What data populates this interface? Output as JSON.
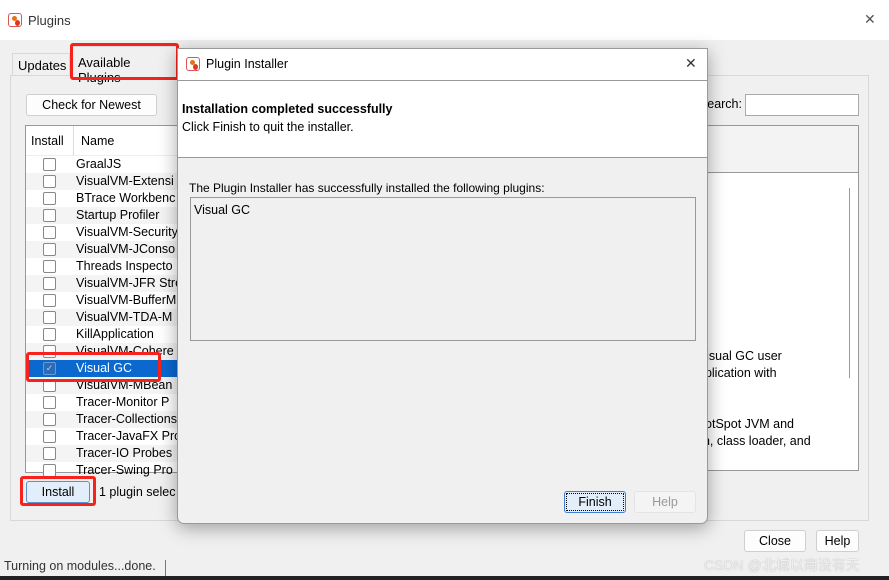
{
  "window": {
    "title": "Plugins",
    "close": "✕"
  },
  "tabs": [
    {
      "label": "Updates"
    },
    {
      "label": "Available Plugins"
    }
  ],
  "toolbar": {
    "check_label": "Check for Newest",
    "search_label": "Search:",
    "search_value": ""
  },
  "table": {
    "headers": [
      "Install",
      "Name"
    ],
    "rows": [
      {
        "name": "GraalJS",
        "checked": false
      },
      {
        "name": "VisualVM-Extensi",
        "checked": false
      },
      {
        "name": "BTrace Workbenc",
        "checked": false
      },
      {
        "name": "Startup Profiler",
        "checked": false
      },
      {
        "name": "VisualVM-Security",
        "checked": false
      },
      {
        "name": "VisualVM-JConso",
        "checked": false
      },
      {
        "name": "Threads Inspecto",
        "checked": false
      },
      {
        "name": "VisualVM-JFR Stre",
        "checked": false
      },
      {
        "name": "VisualVM-BufferM",
        "checked": false
      },
      {
        "name": "VisualVM-TDA-M",
        "checked": false
      },
      {
        "name": "KillApplication",
        "checked": false
      },
      {
        "name": "VisualVM-Cohere",
        "checked": false
      },
      {
        "name": "Visual GC",
        "checked": true,
        "selected": true
      },
      {
        "name": "VisualVM-MBean",
        "checked": false
      },
      {
        "name": "Tracer-Monitor P",
        "checked": false
      },
      {
        "name": "Tracer-Collections",
        "checked": false
      },
      {
        "name": "Tracer-JavaFX Pro",
        "checked": false
      },
      {
        "name": "Tracer-IO Probes",
        "checked": false
      },
      {
        "name": "Tracer-Swing Pro",
        "checked": false
      }
    ]
  },
  "details": {
    "lines": [
      "Visual GC user",
      "pplication with",
      "HotSpot JVM and",
      "on, class loader, and"
    ]
  },
  "bottom": {
    "install_label": "Install",
    "selected_text": "1 plugin selec",
    "close_label": "Close",
    "help_label": "Help"
  },
  "status": {
    "text": "Turning on modules...done."
  },
  "dialog": {
    "title": "Plugin Installer",
    "close": "✕",
    "heading": "Installation completed successfully",
    "subheading": "Click Finish to quit the installer.",
    "body_text": "The Plugin Installer has successfully installed the following plugins:",
    "installed": [
      "Visual GC"
    ],
    "finish_label": "Finish",
    "help_label": "Help"
  },
  "watermark": "CSDN @北城以南没有天",
  "colors": {
    "selection": "#0a68cf",
    "highlight": "#f5221e"
  }
}
